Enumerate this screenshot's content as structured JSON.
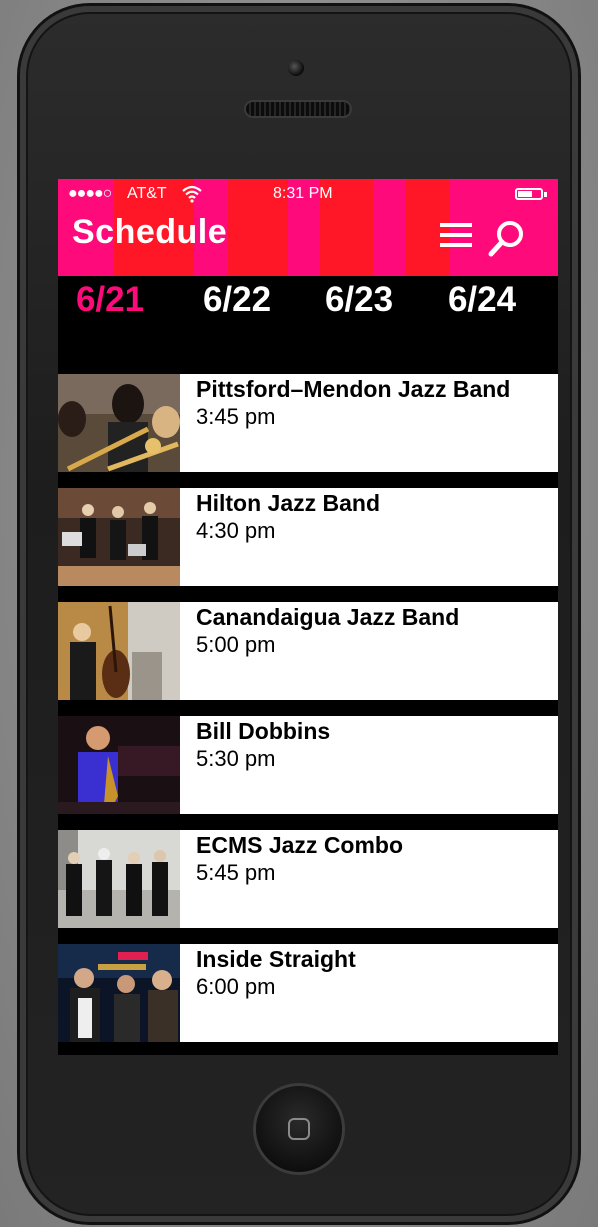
{
  "status_bar": {
    "signal": "●●●●○",
    "carrier": "AT&T",
    "time": "8:31 PM"
  },
  "header": {
    "title": "Schedule",
    "accent_color": "#ff0a7a"
  },
  "date_tabs": [
    {
      "label": "6/21",
      "active": true
    },
    {
      "label": "6/22",
      "active": false
    },
    {
      "label": "6/23",
      "active": false
    },
    {
      "label": "6/24",
      "active": false
    }
  ],
  "schedule": [
    {
      "name": "Pittsford–Mendon Jazz Band",
      "time": "3:45 pm",
      "thumb": "trombone-section-photo"
    },
    {
      "name": "Hilton Jazz Band",
      "time": "4:30 pm",
      "thumb": "band-on-stage-photo"
    },
    {
      "name": "Canandaigua Jazz Band",
      "time": "5:00 pm",
      "thumb": "bassist-photo"
    },
    {
      "name": "Bill Dobbins",
      "time": "5:30 pm",
      "thumb": "saxophonist-photo"
    },
    {
      "name": "ECMS Jazz Combo",
      "time": "5:45 pm",
      "thumb": "group-walking-photo"
    },
    {
      "name": "Inside Straight",
      "time": "6:00 pm",
      "thumb": "band-portrait-photo"
    }
  ]
}
